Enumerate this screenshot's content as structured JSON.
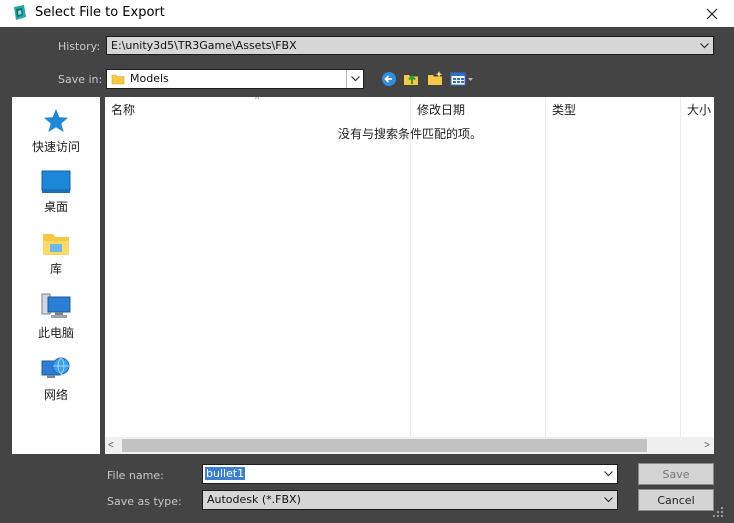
{
  "window": {
    "title": "Select File to Export",
    "logo_icon": "3dsmax-logo-icon",
    "close_icon": "close-icon"
  },
  "history": {
    "label": "History:",
    "value": "E:\\unity3d5\\TR3Game\\Assets\\FBX"
  },
  "save_in": {
    "label": "Save in:",
    "value": "Models",
    "folder_icon": "folder-icon",
    "toolbar": [
      {
        "name": "back-icon"
      },
      {
        "name": "up-folder-icon"
      },
      {
        "name": "new-folder-icon"
      },
      {
        "name": "view-menu-icon"
      }
    ]
  },
  "places": [
    {
      "label": "快速访问",
      "icon": "star-icon"
    },
    {
      "label": "桌面",
      "icon": "desktop-icon"
    },
    {
      "label": "库",
      "icon": "library-icon"
    },
    {
      "label": "此电脑",
      "icon": "computer-icon"
    },
    {
      "label": "网络",
      "icon": "network-icon"
    }
  ],
  "file_list": {
    "columns": [
      "名称",
      "修改日期",
      "类型",
      "大小"
    ],
    "empty_message": "没有与搜索条件匹配的项。"
  },
  "file_name": {
    "label": "File name:",
    "value": "bullet1"
  },
  "save_as_type": {
    "label": "Save as type:",
    "value": "Autodesk (*.FBX)"
  },
  "buttons": {
    "save": "Save",
    "cancel": "Cancel"
  },
  "colors": {
    "dialog_bg": "#444444",
    "selection": "#3b7fd9",
    "accent_blue": "#1e88d8"
  }
}
